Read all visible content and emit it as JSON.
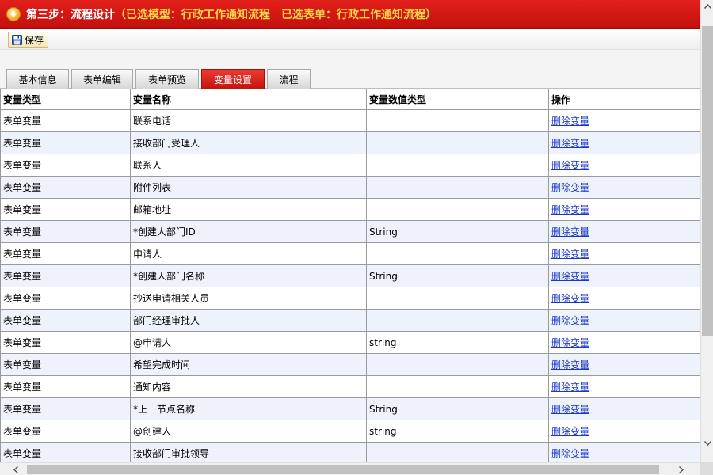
{
  "header": {
    "title": "第三步：流程设计",
    "selected_model": "（已选模型：行政工作通知流程",
    "selected_form": "已选表单：行政工作通知流程）"
  },
  "toolbar": {
    "save_label": "保存"
  },
  "tabs": [
    {
      "label": "基本信息",
      "active": false
    },
    {
      "label": "表单编辑",
      "active": false
    },
    {
      "label": "表单预览",
      "active": false
    },
    {
      "label": "变量设置",
      "active": true
    },
    {
      "label": "流程",
      "active": false
    }
  ],
  "table": {
    "columns": [
      "变量类型",
      "变量名称",
      "变量数值类型",
      "操作"
    ],
    "rows": [
      {
        "type": "表单变量",
        "name": "联系电话",
        "value_type": "",
        "action": "删除变量"
      },
      {
        "type": "表单变量",
        "name": "接收部门受理人",
        "value_type": "",
        "action": "删除变量"
      },
      {
        "type": "表单变量",
        "name": "联系人",
        "value_type": "",
        "action": "删除变量"
      },
      {
        "type": "表单变量",
        "name": "附件列表",
        "value_type": "",
        "action": "删除变量"
      },
      {
        "type": "表单变量",
        "name": "邮箱地址",
        "value_type": "",
        "action": "删除变量"
      },
      {
        "type": "表单变量",
        "name": "*创建人部门ID",
        "value_type": "String",
        "action": "删除变量"
      },
      {
        "type": "表单变量",
        "name": "申请人",
        "value_type": "",
        "action": "删除变量"
      },
      {
        "type": "表单变量",
        "name": "*创建人部门名称",
        "value_type": "String",
        "action": "删除变量"
      },
      {
        "type": "表单变量",
        "name": "抄送申请相关人员",
        "value_type": "",
        "action": "删除变量"
      },
      {
        "type": "表单变量",
        "name": "部门经理审批人",
        "value_type": "",
        "action": "删除变量"
      },
      {
        "type": "表单变量",
        "name": "@申请人",
        "value_type": "string",
        "action": "删除变量"
      },
      {
        "type": "表单变量",
        "name": "希望完成时间",
        "value_type": "",
        "action": "删除变量"
      },
      {
        "type": "表单变量",
        "name": "通知内容",
        "value_type": "",
        "action": "删除变量"
      },
      {
        "type": "表单变量",
        "name": "*上一节点名称",
        "value_type": "String",
        "action": "删除变量"
      },
      {
        "type": "表单变量",
        "name": "@创建人",
        "value_type": "string",
        "action": "删除变量"
      },
      {
        "type": "表单变量",
        "name": "接收部门审批领导",
        "value_type": "",
        "action": "删除变量"
      }
    ]
  },
  "icons": {
    "title": "down-arrow-circle-icon",
    "save": "floppy-disk-icon"
  },
  "colors": {
    "header_red": "#d0150f",
    "header_highlight": "#ffd74a",
    "active_tab": "#d41a14",
    "link": "#1a37c4",
    "row_alt": "#eef2fb"
  }
}
